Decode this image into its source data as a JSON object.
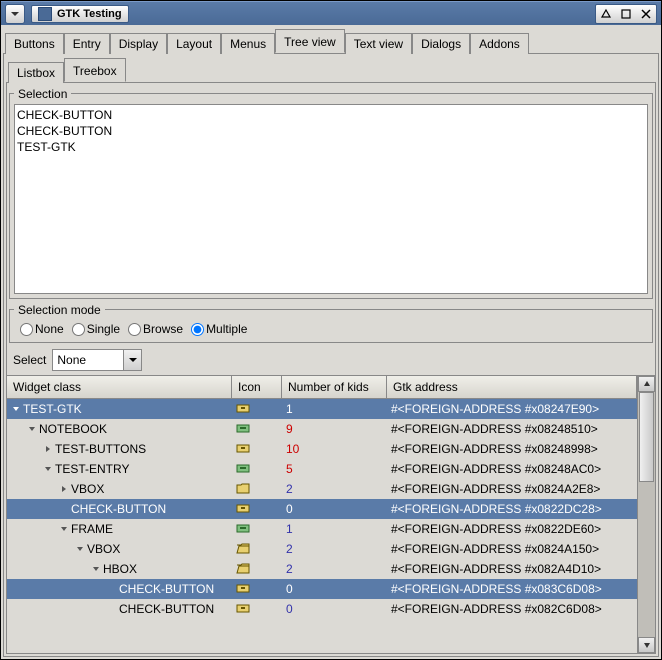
{
  "window": {
    "title": "GTK Testing"
  },
  "tabs": [
    "Buttons",
    "Entry",
    "Display",
    "Layout",
    "Menus",
    "Tree view",
    "Text view",
    "Dialogs",
    "Addons"
  ],
  "active_tab": 5,
  "subtabs": [
    "Listbox",
    "Treebox"
  ],
  "active_subtab": 1,
  "selection_frame_label": "Selection",
  "selection_items": [
    "CHECK-BUTTON",
    "CHECK-BUTTON",
    "TEST-GTK"
  ],
  "selection_mode_label": "Selection mode",
  "selection_modes": [
    "None",
    "Single",
    "Browse",
    "Multiple"
  ],
  "selection_mode_value": "Multiple",
  "select_label": "Select",
  "select_value": "None",
  "columns": {
    "widget": "Widget class",
    "icon": "Icon",
    "kids": "Number of kids",
    "addr": "Gtk address"
  },
  "tree_rows": [
    {
      "depth": 0,
      "expander": "down",
      "label": "TEST-GTK",
      "icon": "drawer",
      "kids": 1,
      "kids_color": "blue",
      "addr": "#<FOREIGN-ADDRESS #x08247E90>",
      "selected": true
    },
    {
      "depth": 1,
      "expander": "down",
      "label": "NOTEBOOK",
      "icon": "drawer-open",
      "kids": 9,
      "kids_color": "red",
      "addr": "#<FOREIGN-ADDRESS #x08248510>",
      "selected": false
    },
    {
      "depth": 2,
      "expander": "right",
      "label": "TEST-BUTTONS",
      "icon": "drawer",
      "kids": 10,
      "kids_color": "red",
      "addr": "#<FOREIGN-ADDRESS #x08248998>",
      "selected": false
    },
    {
      "depth": 2,
      "expander": "down",
      "label": "TEST-ENTRY",
      "icon": "drawer-open",
      "kids": 5,
      "kids_color": "red",
      "addr": "#<FOREIGN-ADDRESS #x08248AC0>",
      "selected": false
    },
    {
      "depth": 3,
      "expander": "right",
      "label": "VBOX",
      "icon": "folder",
      "kids": 2,
      "kids_color": "blue",
      "addr": "#<FOREIGN-ADDRESS #x0824A2E8>",
      "selected": false
    },
    {
      "depth": 3,
      "expander": "none",
      "label": "CHECK-BUTTON",
      "icon": "drawer",
      "kids": 0,
      "kids_color": "blue",
      "addr": "#<FOREIGN-ADDRESS #x0822DC28>",
      "selected": true
    },
    {
      "depth": 3,
      "expander": "down",
      "label": "FRAME",
      "icon": "drawer-open",
      "kids": 1,
      "kids_color": "blue",
      "addr": "#<FOREIGN-ADDRESS #x0822DE60>",
      "selected": false
    },
    {
      "depth": 4,
      "expander": "down",
      "label": "VBOX",
      "icon": "folder-open",
      "kids": 2,
      "kids_color": "blue",
      "addr": "#<FOREIGN-ADDRESS #x0824A150>",
      "selected": false
    },
    {
      "depth": 5,
      "expander": "down",
      "label": "HBOX",
      "icon": "folder-open",
      "kids": 2,
      "kids_color": "blue",
      "addr": "#<FOREIGN-ADDRESS #x082A4D10>",
      "selected": false
    },
    {
      "depth": 6,
      "expander": "none",
      "label": "CHECK-BUTTON",
      "icon": "drawer",
      "kids": 0,
      "kids_color": "blue",
      "addr": "#<FOREIGN-ADDRESS #x083C6D08>",
      "selected": true
    },
    {
      "depth": 6,
      "expander": "none",
      "label": "CHECK-BUTTON",
      "icon": "drawer",
      "kids": 0,
      "kids_color": "blue",
      "addr": "#<FOREIGN-ADDRESS #x082C6D08>",
      "selected": false
    }
  ]
}
